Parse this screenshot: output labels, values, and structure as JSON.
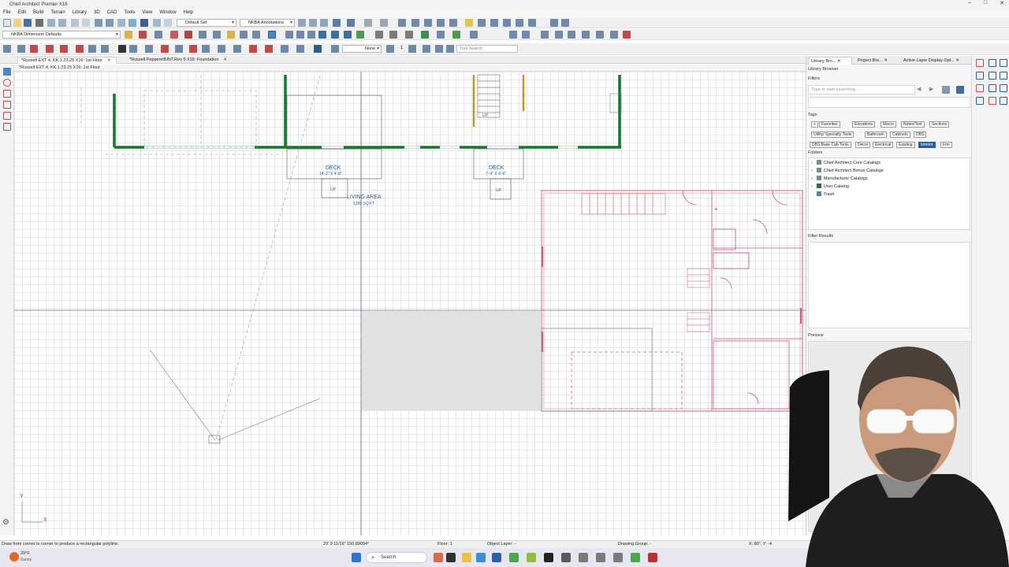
{
  "window": {
    "title": "Chief Architect Premier X16",
    "controls": [
      "–",
      "□",
      "✕"
    ]
  },
  "menu": [
    "File",
    "Edit",
    "Build",
    "Terrain",
    "Library",
    "3D",
    "CAD",
    "Tools",
    "View",
    "Window",
    "Help"
  ],
  "toolbar": {
    "layer_set": "Default Set",
    "annotation_set": "NKBA Annotations",
    "dimension_defaults": "NKBA Dimension Defaults",
    "line_style": "None",
    "line_weight": "1",
    "tool_search_placeholder": "Tool Search"
  },
  "tabs": [
    {
      "label": "*Russell EXT 4, KK.1.23.25 X16: 1st Floor",
      "close": "✕"
    },
    {
      "label": "*Russell.PepperellUNT.Rev 5 X16: Foundation",
      "close": "✕"
    }
  ],
  "view_label": "*Russell EXT 4, KK.1.23.25 X16: 1st Floor",
  "plan": {
    "deck_left": {
      "label": "DECK",
      "size": "14'-2\" X 4'-8\""
    },
    "deck_right": {
      "label": "DECK",
      "size": "7'-4\" X 4'-6\""
    },
    "living": {
      "label": "LIVING AREA",
      "area": "1285 SQ FT"
    },
    "stairs_up": "UP",
    "axis_x": "X",
    "axis_y": "Y"
  },
  "panel": {
    "tabs": [
      "Library Bro...",
      "Project Bro...",
      "Active Layer Display Opt..."
    ],
    "title": "Library Browser",
    "filters_label": "Filters",
    "search_placeholder": "Type to start searching...",
    "tags_label": "Tags",
    "tags_row1": [
      "Favorites",
      "Elevations",
      "Macro",
      "Notes/Text",
      "Sections"
    ],
    "tags_row2": [
      "Utility/ Specialty Tools",
      "Bathroom",
      "Cabinets",
      "DBS"
    ],
    "tags_row3": [
      "DBS Base Cab Tools",
      "Decor",
      "Electrical",
      "Existing",
      "Interior",
      "Iron"
    ],
    "folders_label": "Folders",
    "folders": [
      "Chief Architect Core Catalogs",
      "Chief Architect Bonus Catalogs",
      "Manufacturer Catalogs",
      "User Catalog",
      "Trash"
    ],
    "filter_results_label": "Filter Results",
    "preview_label": "Preview"
  },
  "status": {
    "hint": "Draw from corner to corner to produce a rectangular polyline.",
    "coords": "29' 9 11/16\" 150.89094°",
    "floor": "Floor: 1",
    "object_layer": "Object Layer: -",
    "drawing_group": "Drawing Group: -",
    "xy": "X: 80\", Y: -4"
  },
  "taskbar": {
    "weather_temp": "29°F",
    "weather_desc": "Sunny",
    "search": "Search"
  },
  "colors": {
    "wall_green": "#137a2c",
    "overlay_red": "#d0506a",
    "label_blue": "#2b5c8f",
    "accent": "#1f5fa8"
  }
}
